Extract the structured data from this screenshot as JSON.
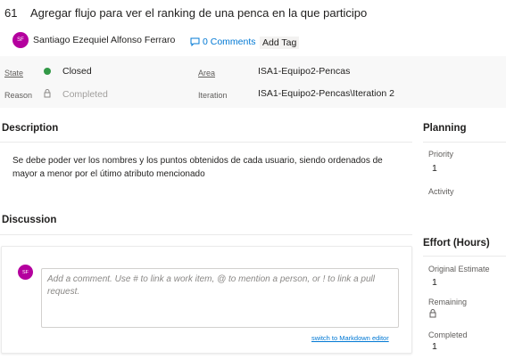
{
  "work_item": {
    "id": "61",
    "title": "Agregar flujo para ver el ranking de una penca en la que participo"
  },
  "owner": {
    "initials": "SF",
    "name": "Santiago Ezequiel Alfonso Ferraro"
  },
  "header_actions": {
    "comments_label": "0 Comments",
    "add_tag_label": "Add Tag"
  },
  "details": {
    "state_label": "State",
    "state_value": "Closed",
    "state_color": "#339947",
    "reason_label": "Reason",
    "reason_value": "Completed",
    "area_label": "Area",
    "area_value": "ISA1-Equipo2-Pencas",
    "iteration_label": "Iteration",
    "iteration_value": "ISA1-Equipo2-Pencas\\Iteration 2"
  },
  "description": {
    "heading": "Description",
    "text": "Se debe poder ver los nombres y los puntos obtenidos de cada usuario, siendo ordenados de mayor a menor por el útimo atributo mencionado"
  },
  "discussion": {
    "heading": "Discussion",
    "avatar_initials": "SF",
    "placeholder": "Add a comment. Use # to link a work item, @ to mention a person, or ! to link a pull request.",
    "markdown_link": "switch to Markdown editor"
  },
  "planning": {
    "heading": "Planning",
    "priority_label": "Priority",
    "priority_value": "1",
    "activity_label": "Activity"
  },
  "effort": {
    "heading": "Effort (Hours)",
    "original_estimate_label": "Original Estimate",
    "original_estimate_value": "1",
    "remaining_label": "Remaining",
    "completed_label": "Completed",
    "completed_value": "1"
  },
  "colors": {
    "accent": "#0078d4",
    "avatar": "#b4009e"
  },
  "icons": [
    "comment-icon",
    "lock-icon"
  ]
}
